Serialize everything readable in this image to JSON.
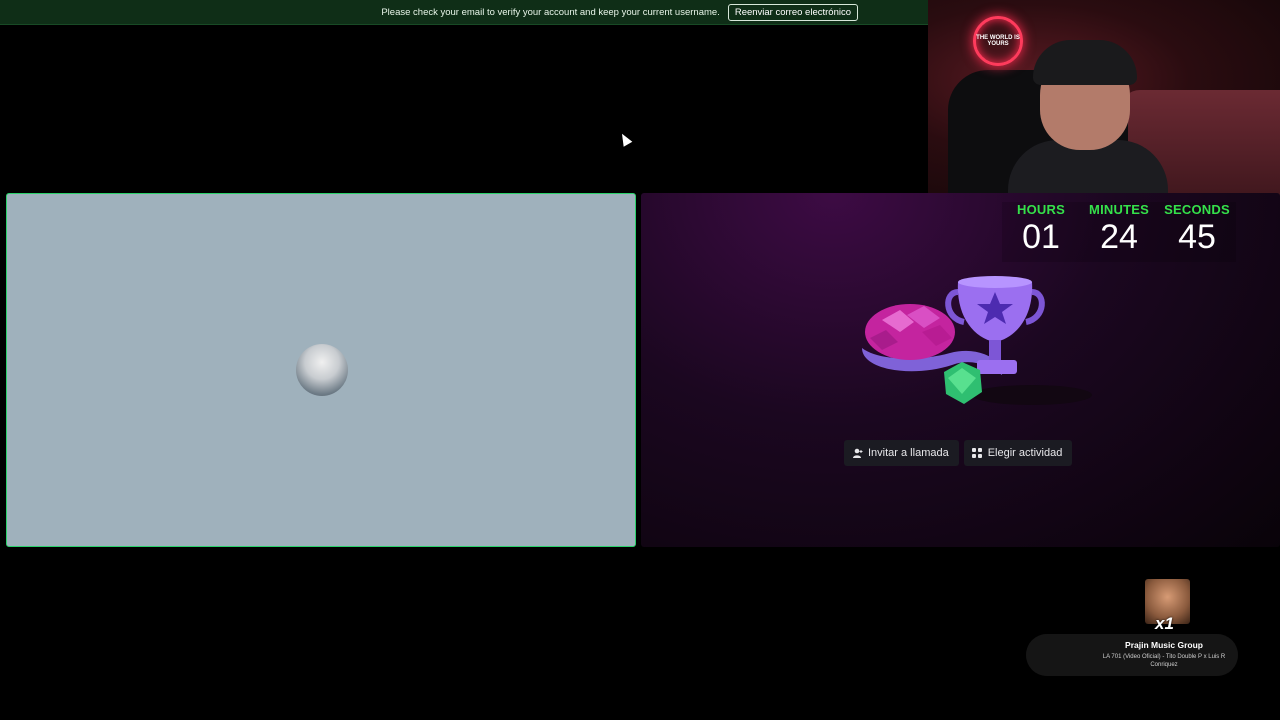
{
  "banner": {
    "message": "Please check your email to verify your account and keep your current username.",
    "resend_label": "Reenviar correo electrónico"
  },
  "webcam": {
    "neon_sign": "THE WORLD IS YOURS"
  },
  "timer": {
    "hours_label": "HOURS",
    "hours_value": "01",
    "minutes_label": "MINUTES",
    "minutes_value": "24",
    "seconds_label": "SECONDS",
    "seconds_value": "45"
  },
  "actions": {
    "invite_label": "Invitar a llamada",
    "activity_label": "Elegir actividad"
  },
  "now_playing": {
    "title": "Prajin Music Group",
    "subtitle": "LA 701 (Video Oficial) - Tito Double P x Luis R Conriquez"
  },
  "emote": {
    "count": "x1"
  },
  "colors": {
    "banner_bg": "#0f2e17",
    "timer_label": "#35e04a",
    "speaking_border": "#2bd16b",
    "left_tile_bg": "#9fb1bc"
  }
}
